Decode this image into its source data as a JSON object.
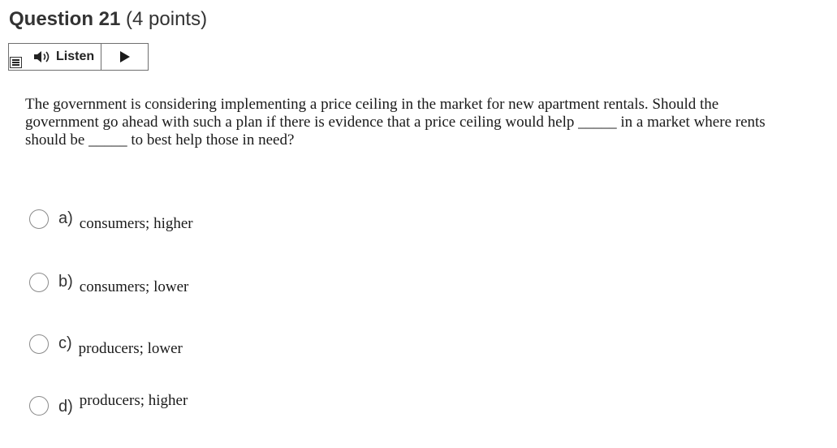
{
  "question": {
    "title": "Question 21",
    "points": "(4 points)"
  },
  "toolbar": {
    "menu_icon": "menu-icon",
    "speaker_icon": "speaker-icon",
    "listen_label": "Listen",
    "play_icon": "play-icon"
  },
  "stem": {
    "text": "The government is considering implementing a price ceiling in the market for new apartment rentals. Should the government go ahead with such a plan if there is evidence that a price ceiling would help _____ in a market where rents should be _____ to best help those in need?"
  },
  "options": [
    {
      "letter": "a)",
      "text": "consumers; higher"
    },
    {
      "letter": "b)",
      "text": "consumers; lower"
    },
    {
      "letter": "c)",
      "text": "producers; lower"
    },
    {
      "letter": "d)",
      "text": "producers; higher"
    }
  ]
}
